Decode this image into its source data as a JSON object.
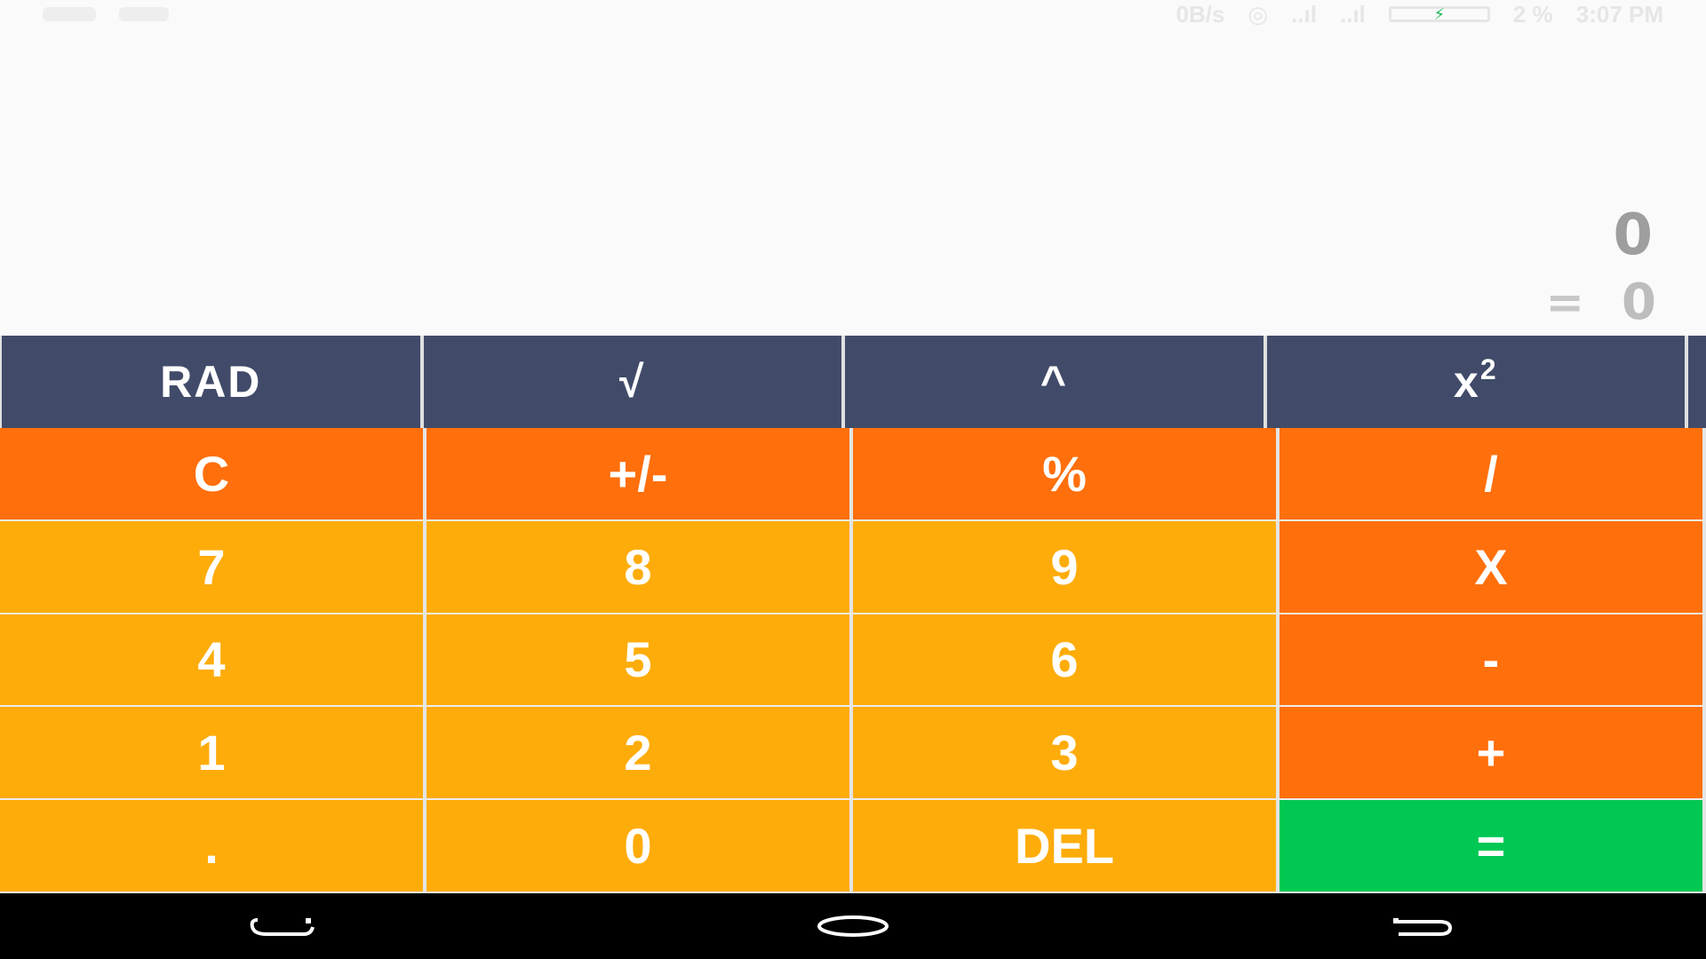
{
  "status_bar": {
    "network_speed": "0B/s",
    "battery_percent": "2 %",
    "time": "3:07 PM",
    "charging_color": "#1db954"
  },
  "display": {
    "expression": "0",
    "equals": "=",
    "result": "0"
  },
  "scientific_keys": [
    {
      "label": "RAD",
      "icon": ""
    },
    {
      "label": "√",
      "icon": ""
    },
    {
      "label": "^",
      "icon": ""
    },
    {
      "label": "x",
      "sup": "2"
    }
  ],
  "keys": [
    {
      "label": "C",
      "type": "op"
    },
    {
      "label": "+/-",
      "type": "op"
    },
    {
      "label": "%",
      "type": "op"
    },
    {
      "label": "/",
      "type": "op"
    },
    {
      "label": "7",
      "type": "num"
    },
    {
      "label": "8",
      "type": "num"
    },
    {
      "label": "9",
      "type": "num"
    },
    {
      "label": "X",
      "type": "op"
    },
    {
      "label": "4",
      "type": "num"
    },
    {
      "label": "5",
      "type": "num"
    },
    {
      "label": "6",
      "type": "num"
    },
    {
      "label": "-",
      "type": "op"
    },
    {
      "label": "1",
      "type": "num"
    },
    {
      "label": "2",
      "type": "num"
    },
    {
      "label": "3",
      "type": "num"
    },
    {
      "label": "+",
      "type": "op"
    },
    {
      "label": ".",
      "type": "num"
    },
    {
      "label": "0",
      "type": "num"
    },
    {
      "label": "DEL",
      "type": "num"
    },
    {
      "label": "=",
      "type": "eq"
    }
  ],
  "colors": {
    "sci_bg": "#414b69",
    "operator": "#ff6f0c",
    "number": "#feac0a",
    "equals": "#00c853",
    "nav_bar": "#000000"
  },
  "nav_bar": {
    "icons": [
      "back-icon",
      "home-icon",
      "recents-icon"
    ]
  }
}
